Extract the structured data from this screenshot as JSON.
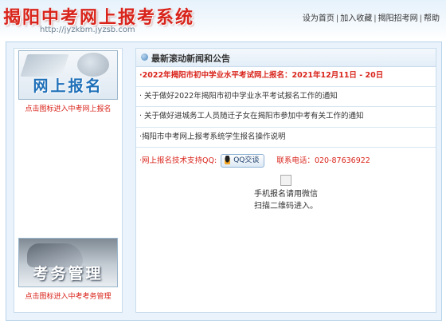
{
  "header": {
    "title": "揭阳中考网上报考系统",
    "url": "http://jyzkbm.jyzsb.com",
    "links": [
      "设为首页",
      "加入收藏",
      "揭阳招考网",
      "帮助"
    ]
  },
  "left": {
    "banner1": {
      "text": "网上报名",
      "caption": "点击图标进入中考网上报名"
    },
    "banner2": {
      "text": "考务管理",
      "caption": "点击图标进入中考考务管理"
    }
  },
  "panel": {
    "title": "最新滚动新闻和公告",
    "news": [
      "·2022年揭阳市初中学业水平考试网上报名：2021年12月11日 - 20日",
      "· 关于做好2022年揭阳市初中学业水平考试报名工作的通知",
      "· 关于做好进城务工人员随迁子女在揭阳市参加中考有关工作的通知",
      "·揭阳市中考网上报考系统学生报名操作说明"
    ],
    "support_label": "·网上报名技术支持QQ:",
    "qq_button": "QQ交谈",
    "tel_label": "联系电话：",
    "tel": "020-87636922",
    "qr_lines": [
      "手机报名请用微信",
      "扫描二维码进入。"
    ]
  },
  "colors": {
    "accent_red": "#d9241b",
    "brand_blue": "#1e6fb8",
    "frame_bg": "#eaf3fb",
    "border": "#c8dcec"
  }
}
